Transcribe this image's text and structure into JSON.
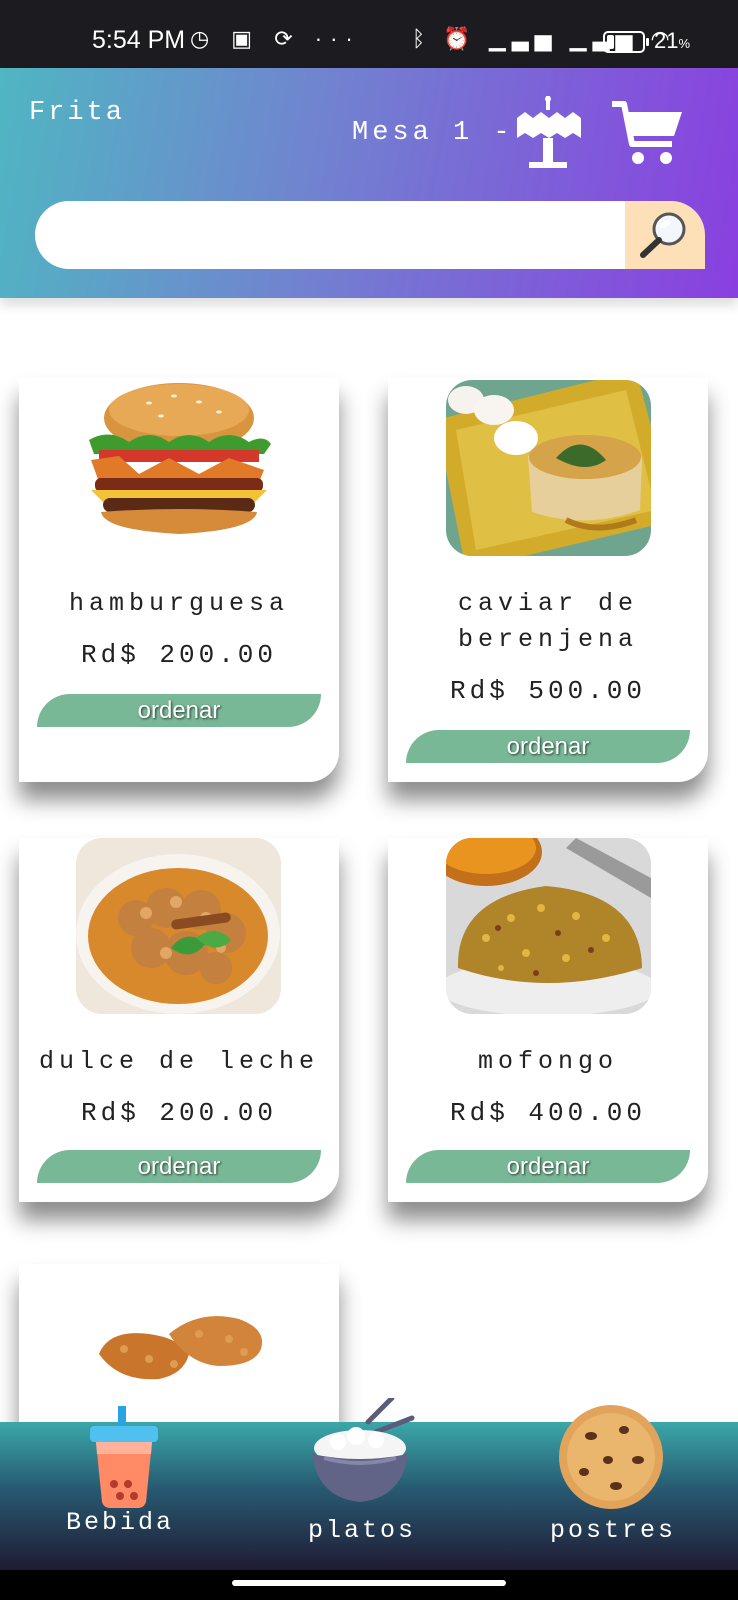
{
  "status_bar": {
    "time": "5:54 PM",
    "left_icons": [
      "whatsapp-icon",
      "sim-icon",
      "sync-icon",
      "more-icon"
    ],
    "left_glyphs": "◷ ▣ ⟳ ···",
    "right_icons": [
      "bluetooth-icon",
      "alarm-icon",
      "signal-icon",
      "signal-icon",
      "wifi-icon",
      "battery-icon"
    ],
    "right_glyphs": "ᛒ ⏰ ▁▃▅ ▁▃▅ ◠",
    "battery_percent": "21",
    "battery_unit": "%",
    "battery_level": 0.21
  },
  "header": {
    "brand": "Frita",
    "table_label": "Mesa 1 -",
    "search": {
      "value": "",
      "placeholder": ""
    },
    "gradient": [
      "#4fb6c2",
      "#8a3fe0"
    ]
  },
  "products": [
    {
      "name": "hamburguesa",
      "price": "Rd$ 200.00",
      "button": "ordenar",
      "image": "burger"
    },
    {
      "name": "caviar de berenjena",
      "price": "Rd$ 500.00",
      "button": "ordenar",
      "image": "caviar"
    },
    {
      "name": "dulce de leche",
      "price": "Rd$ 200.00",
      "button": "ordenar",
      "image": "dulce"
    },
    {
      "name": "mofongo",
      "price": "Rd$ 400.00",
      "button": "ordenar",
      "image": "mofongo"
    },
    {
      "name": "",
      "price": "",
      "button": "",
      "image": "fried-chicken"
    }
  ],
  "bottom_nav": [
    {
      "label": "Bebida",
      "icon": "drink-icon"
    },
    {
      "label": "platos",
      "icon": "rice-bowl-icon"
    },
    {
      "label": "postres",
      "icon": "cookie-icon"
    }
  ],
  "colors": {
    "order_button": "#78b896",
    "search_button": "#fde0b8"
  }
}
